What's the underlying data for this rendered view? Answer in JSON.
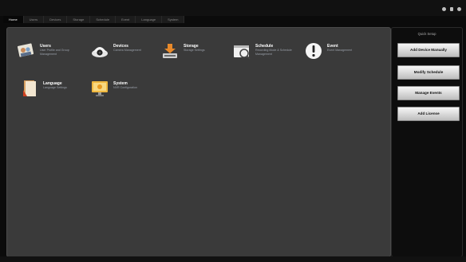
{
  "tabs": [
    "Home",
    "Users",
    "Devices",
    "Storage",
    "Schedule",
    "Event",
    "Language",
    "System"
  ],
  "tiles": [
    {
      "title": "Users",
      "subtitle": "User Profile and Group Management",
      "icon": "users-icon"
    },
    {
      "title": "Devices",
      "subtitle": "Camera Management",
      "icon": "camera-icon"
    },
    {
      "title": "Storage",
      "subtitle": "Storage Settings",
      "icon": "storage-icon"
    },
    {
      "title": "Schedule",
      "subtitle": "Recording Mode & Schedule Management",
      "icon": "schedule-icon"
    },
    {
      "title": "Event",
      "subtitle": "Event Management",
      "icon": "event-icon"
    },
    {
      "title": "Language",
      "subtitle": "Language Settings",
      "icon": "language-icon"
    },
    {
      "title": "System",
      "subtitle": "NVR Configuration",
      "icon": "system-icon"
    }
  ],
  "quick_setup": {
    "title": "Quick Setup",
    "buttons": [
      "Add Device Manually",
      "Modify Schedule",
      "Manage Events",
      "Add License"
    ]
  }
}
